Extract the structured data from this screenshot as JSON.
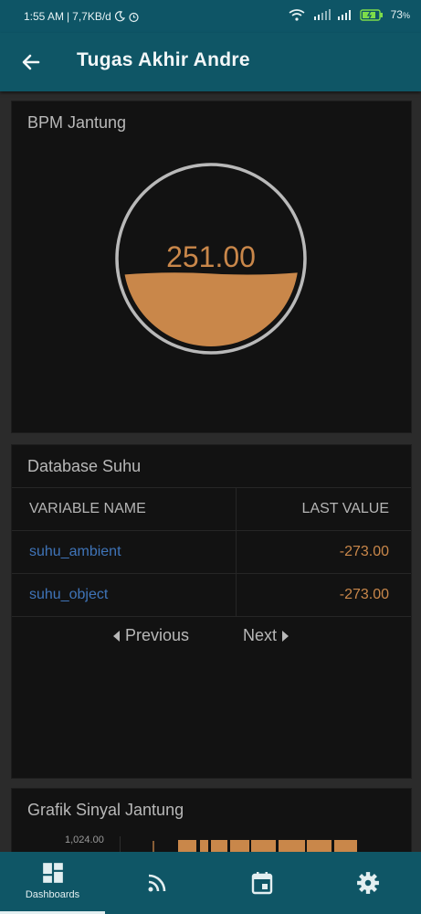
{
  "status_bar": {
    "time": "1:55 AM",
    "speed": "7,7KB/d",
    "battery": "73",
    "battery_unit": "%"
  },
  "app_bar": {
    "title": "Tugas Akhir Andre",
    "back_icon": "arrow-left-icon"
  },
  "bpm_card": {
    "title": "BPM Jantung",
    "value": "251.00",
    "fill_fraction": 0.42,
    "fill_color": "#c9874a"
  },
  "db_card": {
    "title": "Database Suhu",
    "columns": [
      "VARIABLE NAME",
      "LAST VALUE"
    ],
    "rows": [
      {
        "name": "suhu_ambient",
        "value": "-273.00"
      },
      {
        "name": "suhu_object",
        "value": "-273.00"
      }
    ],
    "prev_label": "Previous",
    "next_label": "Next"
  },
  "graph_card": {
    "title": "Grafik Sinyal Jantung",
    "y_tick": "1,024.00"
  },
  "bottom_nav": {
    "items": [
      {
        "label": "Dashboards",
        "icon": "dashboard-icon",
        "active": true
      },
      {
        "label": "",
        "icon": "rss-feed-icon",
        "active": false
      },
      {
        "label": "",
        "icon": "calendar-icon",
        "active": false
      },
      {
        "label": "",
        "icon": "settings-gear-icon",
        "active": false
      }
    ]
  },
  "colors": {
    "primary": "#0f5666",
    "accent": "#c9874a",
    "link": "#3f74b8",
    "card_bg": "#121212"
  }
}
